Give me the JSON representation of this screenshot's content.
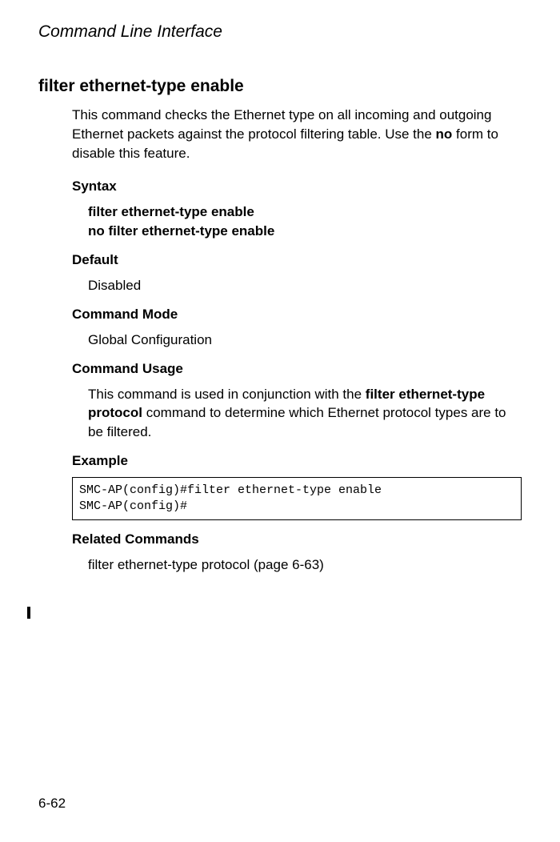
{
  "header": {
    "title": "Command Line Interface"
  },
  "command": {
    "name": "filter ethernet-type enable",
    "description_before_bold": "This command checks the Ethernet type on all incoming and outgoing Ethernet packets against the protocol filtering table. Use the ",
    "description_bold": "no",
    "description_after_bold": " form to disable this feature."
  },
  "syntax": {
    "heading": "Syntax",
    "line1": "filter ethernet-type enable",
    "line2": "no filter ethernet-type enable"
  },
  "default": {
    "heading": "Default",
    "value": "Disabled"
  },
  "command_mode": {
    "heading": "Command Mode",
    "value": "Global Configuration"
  },
  "command_usage": {
    "heading": "Command Usage",
    "before_bold": "This command is used in conjunction with the ",
    "bold": "filter ethernet-type protocol",
    "after_bold": " command to determine which Ethernet protocol types are to be filtered."
  },
  "example": {
    "heading": "Example",
    "code": "SMC-AP(config)#filter ethernet-type enable\nSMC-AP(config)#"
  },
  "related_commands": {
    "heading": "Related Commands",
    "text": "filter ethernet-type protocol (page 6-63)"
  },
  "page_number": "6-62"
}
